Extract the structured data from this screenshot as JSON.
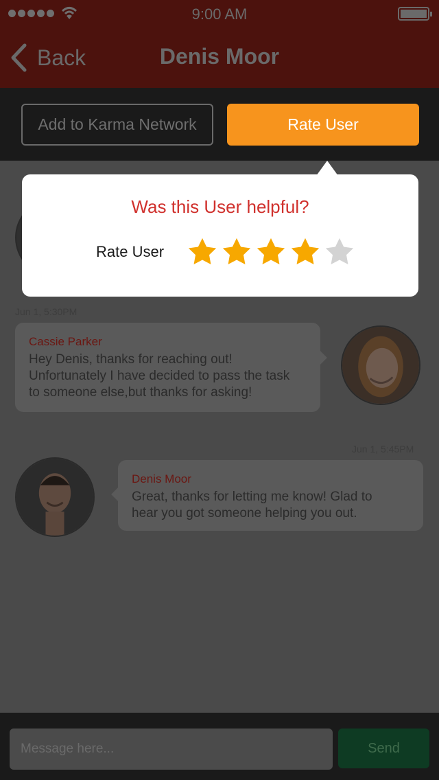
{
  "status": {
    "time": "9:00 AM"
  },
  "nav": {
    "back_label": "Back",
    "title": "Denis Moor"
  },
  "actions": {
    "karma_label": "Add to Karma Network",
    "rate_label": "Rate User"
  },
  "messages": [
    {
      "timestamp": "Jun 1, 5:30PM",
      "sender": "Cassie Parker",
      "text": "Hey Denis, thanks for reaching out!\nUnfortunately I have decided to pass the task\nto someone else,but thanks for asking!"
    },
    {
      "timestamp": "Jun 1, 5:45PM",
      "sender": "Denis Moor",
      "text": "Great, thanks for letting me know! Glad to\nhear you got someone helping you out."
    }
  ],
  "composer": {
    "placeholder": "Message here...",
    "send_label": "Send"
  },
  "rating_popup": {
    "question": "Was this User helpful?",
    "label": "Rate User",
    "rating": 4,
    "max_rating": 5,
    "colors": {
      "filled": "#f7a800",
      "empty": "#d3d3d3",
      "question": "#d0312d"
    }
  },
  "colors": {
    "nav_bg": "#4c120d",
    "accent": "#f7941d",
    "send_bg": "#0e3b23"
  }
}
